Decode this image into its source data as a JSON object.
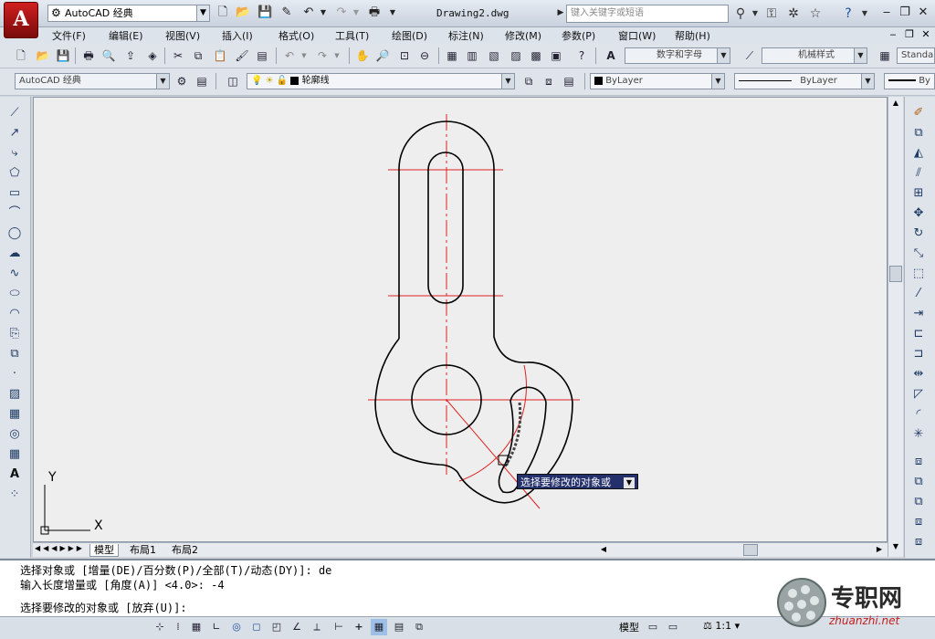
{
  "title_bar": {
    "workspace": "AutoCAD 经典",
    "document_title": "Drawing2.dwg",
    "search_placeholder": "键入关键字或短语"
  },
  "menu": [
    "文件(F)",
    "编辑(E)",
    "视图(V)",
    "插入(I)",
    "格式(O)",
    "工具(T)",
    "绘图(D)",
    "标注(N)",
    "修改(M)",
    "参数(P)",
    "窗口(W)",
    "帮助(H)"
  ],
  "toolbar": {
    "text_style": "数字和字母",
    "dim_style": "机械样式",
    "table_style": "Standa"
  },
  "layers_bar": {
    "workspace": "AutoCAD 经典",
    "layer_name": "轮廓线",
    "color": "ByLayer",
    "linetype": "ByLayer",
    "lineweight": "By"
  },
  "ucs": {
    "x_label": "X",
    "y_label": "Y"
  },
  "tabs": [
    "模型",
    "布局1",
    "布局2"
  ],
  "tooltip": "选择要修改的对象或",
  "command": {
    "line1": "选择对象或 [增量(DE)/百分数(P)/全部(T)/动态(DY)]: de",
    "line2": "输入长度增量或 [角度(A)] <4.0>: -4",
    "prompt": "选择要修改的对象或 [放弃(U)]:"
  },
  "status": {
    "model_label": "模型",
    "scale": "1:1"
  },
  "watermark": {
    "text": "专职网",
    "url": "zhuanzhi.net"
  },
  "colors": {
    "centerline": "#e02020",
    "outline": "#000000",
    "canvas": "#eeeeee",
    "tooltip_bg": "#24306b"
  }
}
